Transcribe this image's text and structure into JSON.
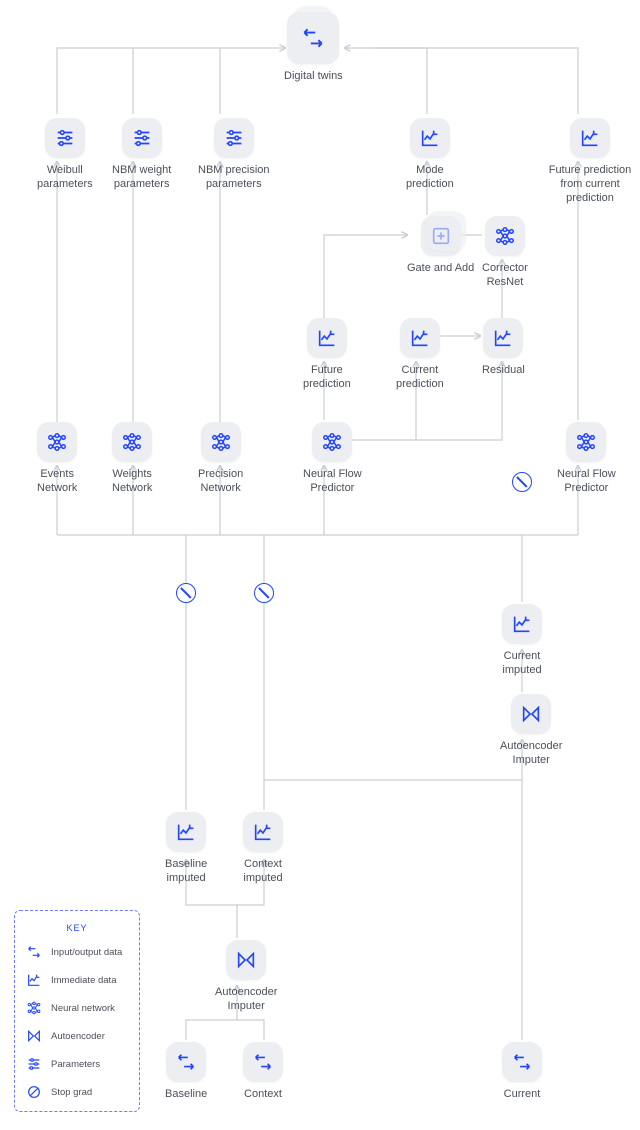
{
  "title": "Digital twins architecture diagram",
  "nodes": {
    "digital_twins": "Digital twins",
    "weibull_params": "Weibull\nparameters",
    "nbm_weight": "NBM weight\nparameters",
    "nbm_precision": "NBM precision\nparameters",
    "mode_prediction": "Mode\nprediction",
    "future_pred_from_cur": "Future prediction\nfrom current prediction",
    "gate_add": "Gate and Add",
    "corrector": "Corrector\nResNet",
    "future_pred": "Future\nprediction",
    "current_pred": "Current\nprediction",
    "residual": "Residual",
    "events_net": "Events\nNetwork",
    "weights_net": "Weights\nNetwork",
    "precision_net": "Precision\nNetwork",
    "nfp_left": "Neural Flow\nPredictor",
    "nfp_right": "Neural Flow\nPredictor",
    "current_imputed": "Current\nimputed",
    "autoencoder2": "Autoencoder\nImputer",
    "baseline_imputed": "Baseline\nimputed",
    "context_imputed": "Context\nimputed",
    "autoencoder1": "Autoencoder\nImputer",
    "baseline": "Baseline",
    "context": "Context",
    "current": "Current"
  },
  "key": {
    "title": "KEY",
    "items": [
      {
        "icon": "io",
        "label": "Input/output data"
      },
      {
        "icon": "immediate",
        "label": "Immediate data"
      },
      {
        "icon": "nn",
        "label": "Neural network"
      },
      {
        "icon": "ae",
        "label": "Autoencoder"
      },
      {
        "icon": "params",
        "label": "Parameters"
      },
      {
        "icon": "stopgrad",
        "label": "Stop grad"
      }
    ]
  },
  "colors": {
    "accent": "#2245ff",
    "node_bg": "#eceef2",
    "line": "#c9ced7",
    "text": "#4a4f5a"
  }
}
